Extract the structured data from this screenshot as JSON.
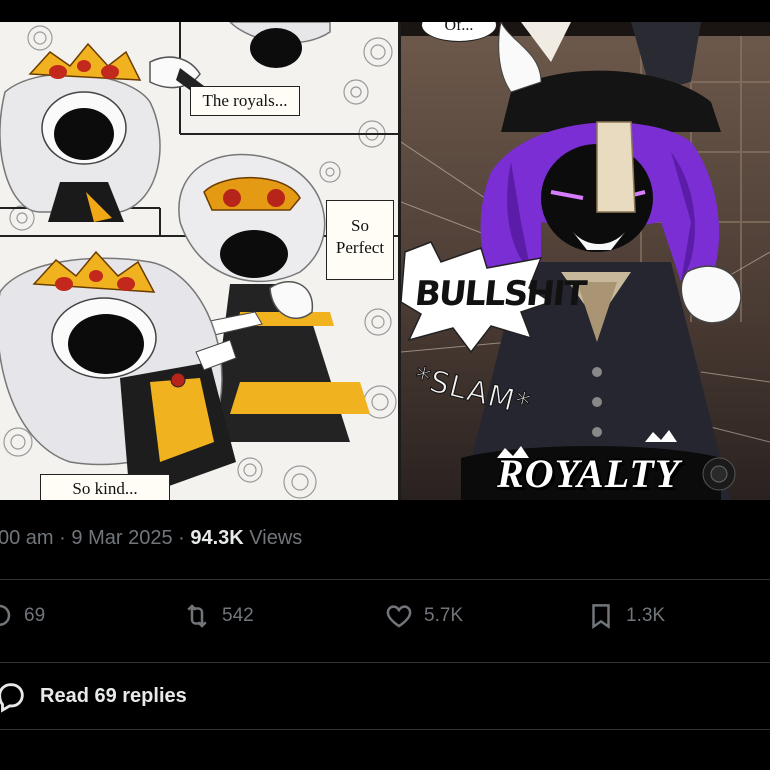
{
  "media": {
    "left_panel": {
      "caption_top": "The royals...",
      "caption_right": "So Perfect",
      "caption_bottom": "So kind..."
    },
    "right_panel": {
      "speech_top": "Of...",
      "sfx_shout": "BULLSHIT",
      "sfx_slam": "*SLAM*",
      "title_banner": "ROYALTY"
    }
  },
  "meta": {
    "time": "00 am",
    "date": "9 Mar 2025",
    "views_count": "94.3K",
    "views_label": "Views",
    "separator": "·"
  },
  "actions": {
    "reply": {
      "icon": "reply-icon",
      "count": "69"
    },
    "retweet": {
      "icon": "retweet-icon",
      "count": "542"
    },
    "like": {
      "icon": "heart-icon",
      "count": "5.7K"
    },
    "bookmark": {
      "icon": "bookmark-icon",
      "count": "1.3K"
    }
  },
  "read_replies": {
    "icon": "reply-icon",
    "label": "Read 69 replies"
  },
  "colors": {
    "background": "#000000",
    "text_primary": "#e7e9ea",
    "text_secondary": "#71767b",
    "divider": "#2f3336",
    "royal_purple": "#7b2fd1",
    "royal_gold": "#e8a51a"
  }
}
